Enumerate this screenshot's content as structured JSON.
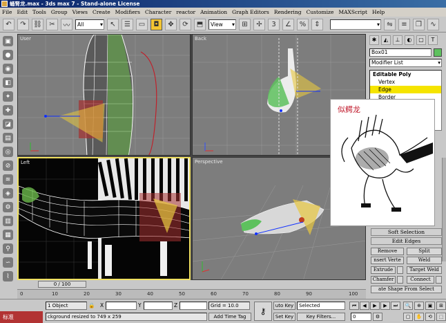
{
  "window": {
    "title": "蛹腎龙.max - 3ds max 7 - Stand-alone License"
  },
  "menu": [
    "File",
    "Edit",
    "Tools",
    "Group",
    "Views",
    "Create",
    "Modifiers",
    "Character",
    "reactor",
    "Animation",
    "Graph Editors",
    "Rendering",
    "Customize",
    "MAXScript",
    "Help"
  ],
  "toolbar": {
    "selection_filter": "All",
    "ref_coord": "View"
  },
  "viewports": [
    {
      "label": "User"
    },
    {
      "label": "Back"
    },
    {
      "label": "Left"
    },
    {
      "label": "Perspective"
    }
  ],
  "command_panel": {
    "object_name": "Box01",
    "modifier_list": "Modifier List",
    "stack": [
      {
        "label": "Editable Poly",
        "level": "head"
      },
      {
        "label": "Vertex",
        "level": "sub"
      },
      {
        "label": "Edge",
        "level": "sub",
        "selected": true
      },
      {
        "label": "Border",
        "level": "sub"
      }
    ],
    "rollouts": {
      "soft_selection": "Soft Selection",
      "edit_edges": "Edit Edges"
    },
    "buttons": {
      "remove": "Remove",
      "split": "Split",
      "insert_vertex": "nsert Verte",
      "weld": "Weld",
      "extrude": "Extrude",
      "target_weld": "Target Weld",
      "chamfer": "Chamfer",
      "connect": "Connect",
      "create_shape": "ate Shape From Select"
    }
  },
  "reference_image": {
    "caption": "似鳄龙"
  },
  "time_slider": {
    "value": "0 / 100"
  },
  "trackbar": {
    "ticks": [
      "0",
      "10",
      "20",
      "30",
      "40",
      "50",
      "60",
      "70",
      "80",
      "90",
      "100"
    ]
  },
  "status": {
    "selection": "1 Object",
    "x_label": "X",
    "y_label": "Y",
    "z_label": "Z",
    "grid": "Grid = 10.0",
    "auto_key": "uto Key",
    "key_mode": "Selected",
    "prompt": "ckground resized to 749 x 259",
    "add_time_tag": "Add Time Tag",
    "set_key": "Set Key",
    "key_filters": "Key Filters...",
    "frame": "0",
    "language": "标准"
  },
  "colors": {
    "title_bar": "#0a246a",
    "selection_yellow": "#f5e400",
    "viewport_bg": "#7d7d7d"
  }
}
